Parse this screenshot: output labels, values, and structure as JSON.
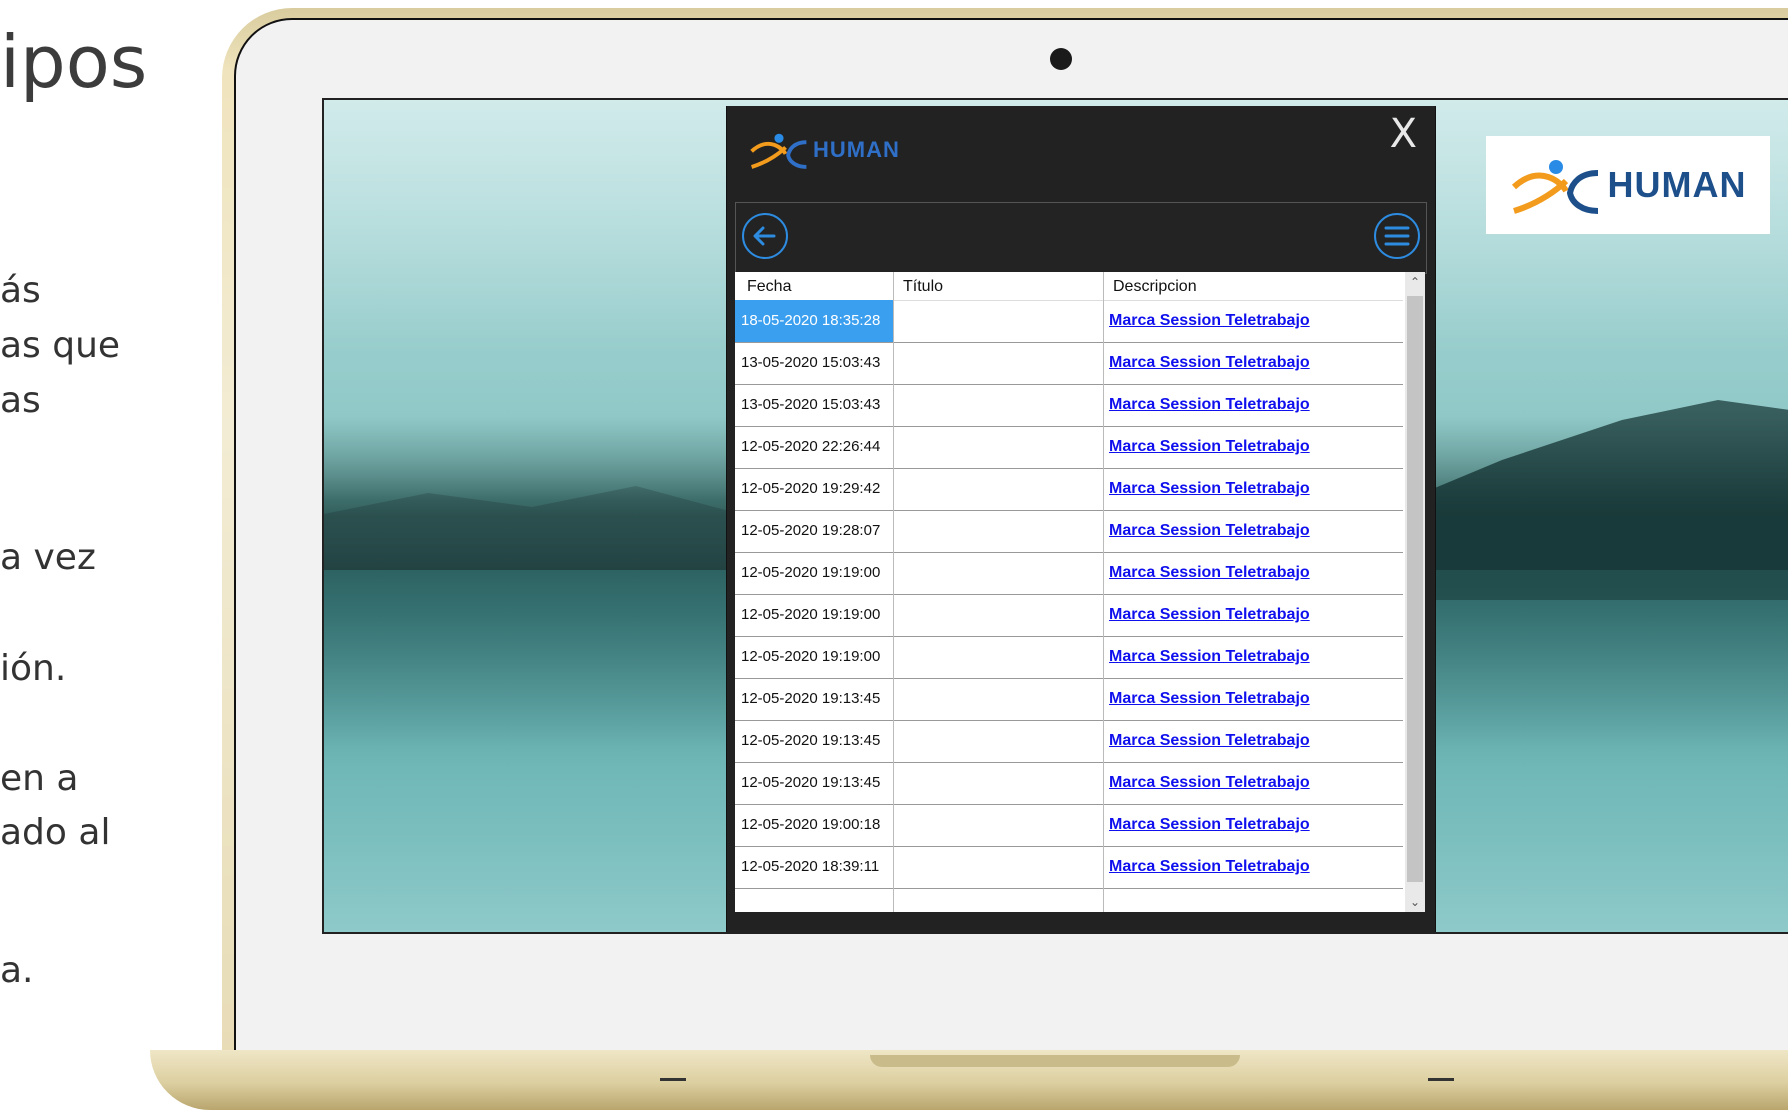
{
  "slide": {
    "title_fragment": "ipos",
    "fragments": [
      "ás",
      "as que",
      "as",
      "a vez",
      "ión.",
      "en a",
      "ado al",
      "a."
    ]
  },
  "brand": {
    "name": "HUMAN",
    "colors": {
      "blue": "#1d4f8b",
      "orange": "#f29b1d",
      "dot": "#2a8be6"
    }
  },
  "app": {
    "logo_name": "HUMAN",
    "close_label": "X",
    "toolbar": {
      "back_icon": "arrow-left-circle-icon",
      "menu_icon": "hamburger-circle-icon"
    },
    "table": {
      "headers": {
        "fecha": "Fecha",
        "titulo": "Título",
        "descripcion": "Descripcion"
      },
      "rows": [
        {
          "fecha": "18-05-2020 18:35:28",
          "titulo": "",
          "descripcion": "Marca Session Teletrabajo",
          "selected": true
        },
        {
          "fecha": "13-05-2020 15:03:43",
          "titulo": "",
          "descripcion": "Marca Session Teletrabajo"
        },
        {
          "fecha": "13-05-2020 15:03:43",
          "titulo": "",
          "descripcion": "Marca Session Teletrabajo"
        },
        {
          "fecha": "12-05-2020 22:26:44",
          "titulo": "",
          "descripcion": "Marca Session Teletrabajo"
        },
        {
          "fecha": "12-05-2020 19:29:42",
          "titulo": "",
          "descripcion": "Marca Session Teletrabajo"
        },
        {
          "fecha": "12-05-2020 19:28:07",
          "titulo": "",
          "descripcion": "Marca Session Teletrabajo"
        },
        {
          "fecha": "12-05-2020 19:19:00",
          "titulo": "",
          "descripcion": "Marca Session Teletrabajo"
        },
        {
          "fecha": "12-05-2020 19:19:00",
          "titulo": "",
          "descripcion": "Marca Session Teletrabajo"
        },
        {
          "fecha": "12-05-2020 19:19:00",
          "titulo": "",
          "descripcion": "Marca Session Teletrabajo"
        },
        {
          "fecha": "12-05-2020 19:13:45",
          "titulo": "",
          "descripcion": "Marca Session Teletrabajo"
        },
        {
          "fecha": "12-05-2020 19:13:45",
          "titulo": "",
          "descripcion": "Marca Session Teletrabajo"
        },
        {
          "fecha": "12-05-2020 19:13:45",
          "titulo": "",
          "descripcion": "Marca Session Teletrabajo"
        },
        {
          "fecha": "12-05-2020 19:00:18",
          "titulo": "",
          "descripcion": "Marca Session Teletrabajo"
        },
        {
          "fecha": "12-05-2020 18:39:11",
          "titulo": "",
          "descripcion": "Marca Session Teletrabajo"
        }
      ]
    }
  }
}
